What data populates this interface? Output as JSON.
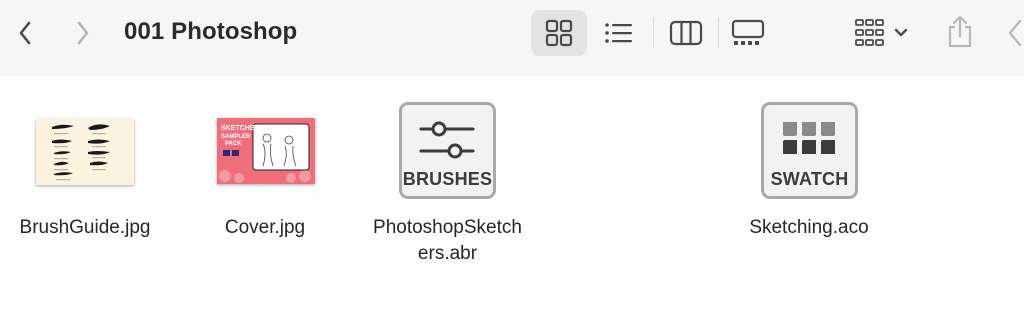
{
  "window": {
    "title": "001 Photoshop"
  },
  "toolbar": {
    "back_icon": "chevron-left-icon",
    "forward_icon": "chevron-right-icon",
    "views": [
      {
        "icon": "icon-view-grid-icon",
        "selected": true
      },
      {
        "icon": "list-view-icon",
        "selected": false
      },
      {
        "icon": "column-view-icon",
        "selected": false
      },
      {
        "icon": "gallery-view-icon",
        "selected": false
      }
    ],
    "group_icon": "group-by-icon",
    "share_icon": "share-icon"
  },
  "files": [
    {
      "name": "BrushGuide.jpg",
      "kind": "image"
    },
    {
      "name": "Cover.jpg",
      "kind": "image"
    },
    {
      "name_line1": "PhotoshopSketch",
      "name_line2": "ers.abr",
      "kind": "document",
      "badge": "BRUSHES"
    },
    {
      "name": "Sketching.aco",
      "kind": "document",
      "badge": "SWATCH"
    }
  ],
  "cover_art_text": {
    "line1": "SKETCHER",
    "line2": "SAMPLER",
    "line3": "PACK"
  },
  "colors": {
    "accent_pink": "#e89aa0",
    "cover_bg": "#f06d7a",
    "brushguide_bg": "#fbf3df"
  }
}
